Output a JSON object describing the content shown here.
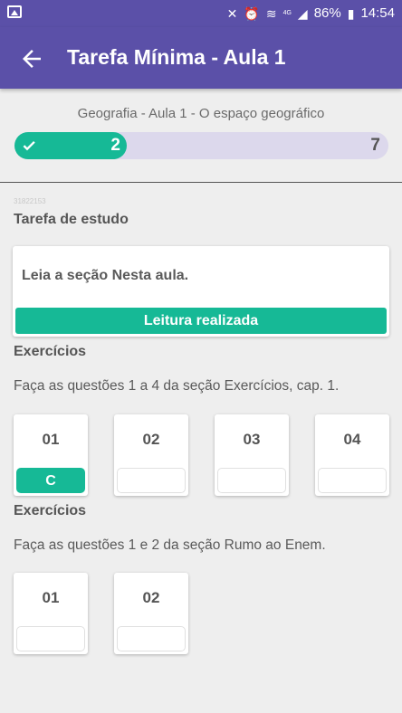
{
  "status_bar": {
    "battery": "86%",
    "time": "14:54",
    "network": "4G",
    "icons": [
      "image-icon",
      "mute-icon",
      "alarm-icon",
      "wifi-icon",
      "signal-icon",
      "battery-icon"
    ]
  },
  "app_bar": {
    "title": "Tarefa Mínima - Aula 1",
    "back_icon": "arrow-left-icon"
  },
  "lesson": {
    "subject": "Geografia - Aula 1 - O espaço geográfico",
    "progress": {
      "done": "2",
      "total": "7",
      "fraction": 0.3
    },
    "code": "31822153"
  },
  "study_task": {
    "title": "Tarefa de estudo",
    "instruction": "Leia a seção Nesta aula.",
    "button_label": "Leitura realizada"
  },
  "exercises_1": {
    "title": "Exercícios",
    "instruction": "Faça as questões 1 a 4 da seção Exercícios, cap. 1.",
    "questions": [
      {
        "number": "01",
        "answer": "C"
      },
      {
        "number": "02",
        "answer": ""
      },
      {
        "number": "03",
        "answer": ""
      },
      {
        "number": "04",
        "answer": ""
      }
    ]
  },
  "exercises_2": {
    "title": "Exercícios",
    "instruction": "Faça as questões 1 e 2 da seção Rumo ao Enem.",
    "questions": [
      {
        "number": "01",
        "answer": ""
      },
      {
        "number": "02",
        "answer": ""
      }
    ]
  },
  "colors": {
    "primary": "#5b50a8",
    "accent": "#16b996",
    "progress_track": "#dcd8ec",
    "background": "#eeeeee"
  }
}
